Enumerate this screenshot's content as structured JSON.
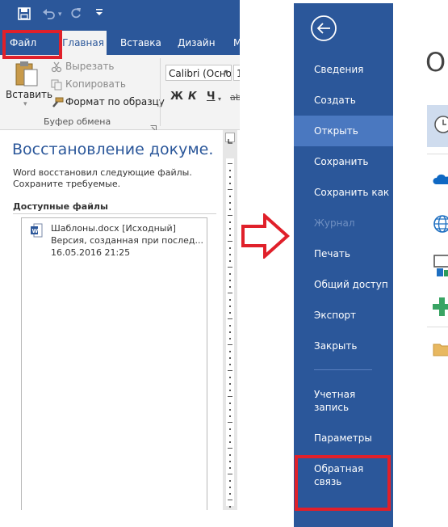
{
  "word_window": {
    "quick_access": {
      "save_icon": "floppy-disk-icon",
      "undo_icon": "undo-icon",
      "undo_dropdown_icon": "chevron-down-icon",
      "redo_icon": "redo-icon",
      "customize_icon": "customize-toolbar-icon"
    },
    "tabs": [
      {
        "label": "Файл"
      },
      {
        "label": "Главная"
      },
      {
        "label": "Вставка"
      },
      {
        "label": "Дизайн"
      },
      {
        "label": "М"
      }
    ],
    "ribbon": {
      "paste_label": "Вставить",
      "cut_label": "Вырезать",
      "copy_label": "Копировать",
      "format_painter_label": "Формат по образцу",
      "clipboard_group_label": "Буфер обмена",
      "font_name": "Calibri (Осно",
      "font_size": "1",
      "bold": "Ж",
      "italic": "К",
      "underline": "Ч",
      "strike": "abc"
    },
    "recovery": {
      "title": "Восстановление докуме...",
      "description_line1": "Word восстановил следующие файлы.",
      "description_line2": "Сохраните требуемые.",
      "available_files_label": "Доступные файлы",
      "files": [
        {
          "name": "Шаблоны.docx  [Исходный]",
          "version": "Версия, созданная при послед...",
          "date": "16.05.2016 21:25"
        }
      ]
    }
  },
  "backstage": {
    "back_icon": "back-arrow-icon",
    "menu_items": [
      {
        "label": "Сведения"
      },
      {
        "label": "Создать"
      },
      {
        "label": "Открыть"
      },
      {
        "label": "Сохранить"
      },
      {
        "label": "Сохранить как"
      },
      {
        "label": "Журнал"
      },
      {
        "label": "Печать"
      },
      {
        "label": "Общий доступ"
      },
      {
        "label": "Экспорт"
      },
      {
        "label": "Закрыть"
      }
    ],
    "bottom_items": [
      {
        "label_line1": "Учетная",
        "label_line2": "запись"
      },
      {
        "label_line1": "Параметры",
        "label_line2": ""
      },
      {
        "label_line1": "Обратная",
        "label_line2": "связь"
      }
    ],
    "content_heading": "О"
  },
  "colors": {
    "word_blue": "#2b579a",
    "selected_item": "#4a78c0",
    "highlight_red": "#e0202a"
  }
}
